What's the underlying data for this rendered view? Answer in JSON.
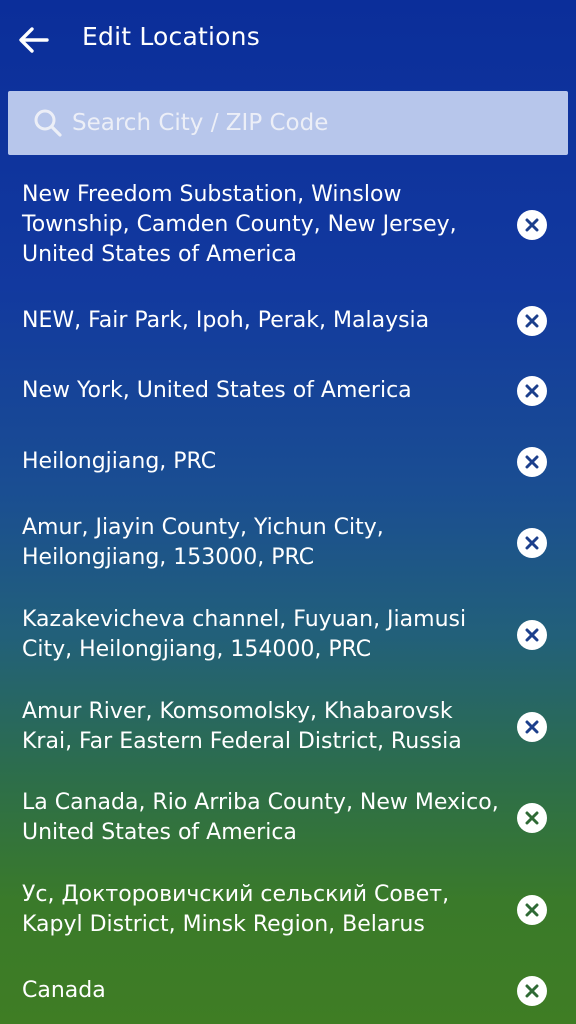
{
  "header": {
    "title": "Edit Locations"
  },
  "search": {
    "placeholder": "Search City / ZIP Code"
  },
  "locations": [
    {
      "label": "New Freedom Substation, Winslow Township, Camden County, New Jersey, United States of America"
    },
    {
      "label": "NEW, Fair Park, Ipoh, Perak, Malaysia"
    },
    {
      "label": "New York, United States of America"
    },
    {
      "label": "Heilongjiang, PRC"
    },
    {
      "label": "Amur, Jiayin County, Yichun City, Heilongjiang, 153000, PRC"
    },
    {
      "label": "Kazakevicheva channel, Fuyuan, Jiamusi City, Heilongjiang, 154000, PRC"
    },
    {
      "label": "Amur River, Komsomolsky, Khabarovsk Krai, Far Eastern Federal District, Russia"
    },
    {
      "label": "La Canada, Rio Arriba County, New Mexico, United States of America"
    },
    {
      "label": "Ус, Докторовичский сельский Совет, Kapyl District, Minsk Region, Belarus"
    },
    {
      "label": "Canada"
    }
  ],
  "colors": {
    "gradient_top": "#0b2e9a",
    "gradient_bottom": "#3f7d24",
    "search_bg": "#c6d3f2",
    "remove_icon": "#1c3f8c"
  }
}
